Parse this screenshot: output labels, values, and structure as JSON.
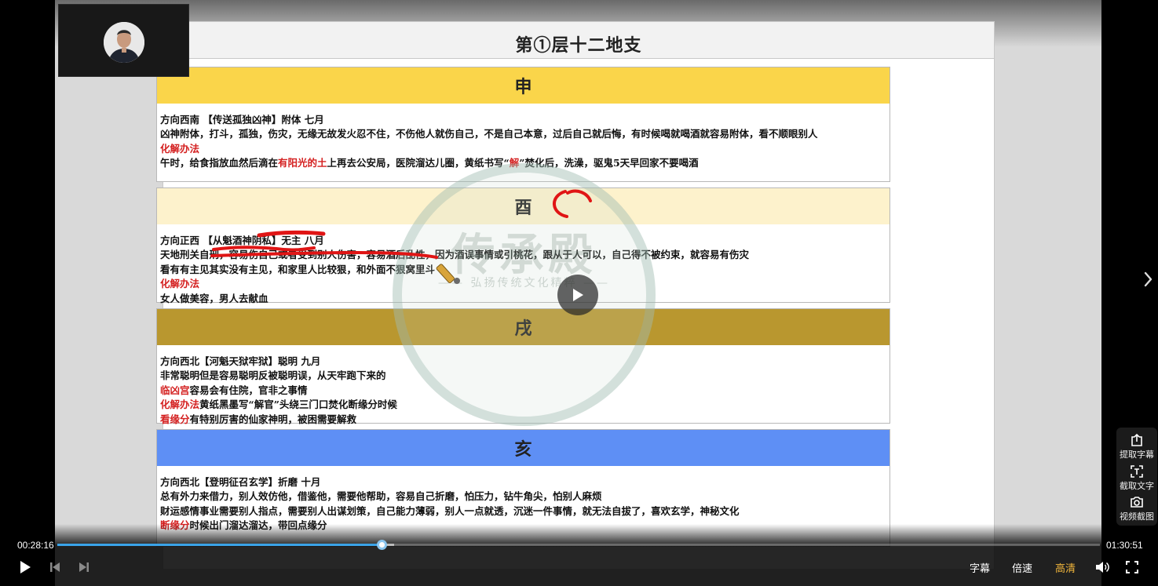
{
  "slide": {
    "title": "第①层十二地支",
    "sections": [
      {
        "heading": "申",
        "lines": [
          [
            {
              "t": "方向西南 【传送孤独凶神】附体 七月"
            }
          ],
          [
            {
              "t": "凶神附体，打斗，孤独，伤灾，无缘无故发火忍不住，不伤他人就伤自己，不是自己本意，过后自己就后悔，有时候喝就喝酒就容易附体，看不顺眼别人"
            }
          ],
          [
            {
              "t": "化解办法",
              "red": true
            }
          ],
          [
            {
              "t": "午时，给食指放血然后滴在"
            },
            {
              "t": "有阳光的土",
              "red": true
            },
            {
              "t": "上再去公安局，医院溜达儿圈，黄纸书写“"
            },
            {
              "t": "解",
              "red": true
            },
            {
              "t": "”焚化后，洗澡，驱鬼5天早回家不要喝酒"
            }
          ]
        ]
      },
      {
        "heading": "酉",
        "lines": [
          [
            {
              "t": "方向正西 【从魁酒神阴私】无主 八月"
            }
          ],
          [
            {
              "t": "天地刑关自刑，容易伤自己或者受到别人伤害，容易酒后乱性，因为酒误事情或引桃花，跟从于人可以，自己得不被约束，就容易有伤灾"
            }
          ],
          [
            {
              "t": "看有有主见其实没有主见，和家里人比较狠，和外面不狠窝里斗"
            }
          ],
          [
            {
              "t": "化解办法",
              "red": true
            }
          ],
          [
            {
              "t": "女人做美容，男人去献血"
            }
          ]
        ]
      },
      {
        "heading": "戌",
        "lines": [
          [
            {
              "t": "方向西北【河魁天狱牢狱】聪明 九月"
            }
          ],
          [
            {
              "t": "非常聪明但是容易聪明反被聪明误，从天牢跑下来的"
            }
          ],
          [
            {
              "t": "临凶宫",
              "red": true
            },
            {
              "t": "容易会有住院，官非之事情"
            }
          ],
          [
            {
              "t": "化解办法",
              "red": true
            },
            {
              "t": "黄纸黑墨写“解官”头绕三门口焚化断缘分时候"
            }
          ],
          [
            {
              "t": "看缘分",
              "red": true
            },
            {
              "t": "有特别厉害的仙家神明，被困需要解救"
            }
          ]
        ]
      },
      {
        "heading": "亥",
        "lines": [
          [
            {
              "t": "方向西北【登明征召玄学】折磨 十月"
            }
          ],
          [
            {
              "t": "总有外力来借力，别人效仿他，借鉴他，需要他帮助，容易自己折磨，怕压力，钻牛角尖，怕别人麻烦"
            }
          ],
          [
            {
              "t": "财运感情事业需要别人指点，需要别人出谋划策，自己能力薄弱，别人一点就透，沉迷一件事情，就无法自拔了，喜欢玄学，神秘文化"
            }
          ],
          [
            {
              "t": "断缘分",
              "red": true
            },
            {
              "t": "时候出门溜达溜达，带回点缘分"
            }
          ]
        ]
      }
    ],
    "watermark": {
      "title": "传承殿",
      "subtitle": "—— 弘扬传统文化精粹 ——"
    }
  },
  "player": {
    "current_time": "00:28:16",
    "total_time": "01:30:51",
    "progress_fraction": 0.311,
    "buffer_fraction": 0.323,
    "subtitle_label": "字幕",
    "speed_label": "倍速",
    "quality_label": "高清",
    "icons": {
      "center_play": "play-icon",
      "play": "play-icon",
      "prev": "skip-previous-icon",
      "next": "skip-next-icon",
      "volume": "volume-icon",
      "fullscreen": "fullscreen-icon",
      "next_page": "chevron-right-icon"
    }
  },
  "side_tools": [
    {
      "label": "提取字幕",
      "icon": "extract-subtitle-icon"
    },
    {
      "label": "截取文字",
      "icon": "capture-text-icon"
    },
    {
      "label": "视频截图",
      "icon": "camera-icon"
    }
  ],
  "colors": {
    "progress": "#3aa3e8",
    "quality_accent": "#f0b53b",
    "red_text": "#d42020",
    "section_heads": [
      "#fad54a",
      "#fdf2cc",
      "#b9972f",
      "#5e8ff5"
    ]
  }
}
